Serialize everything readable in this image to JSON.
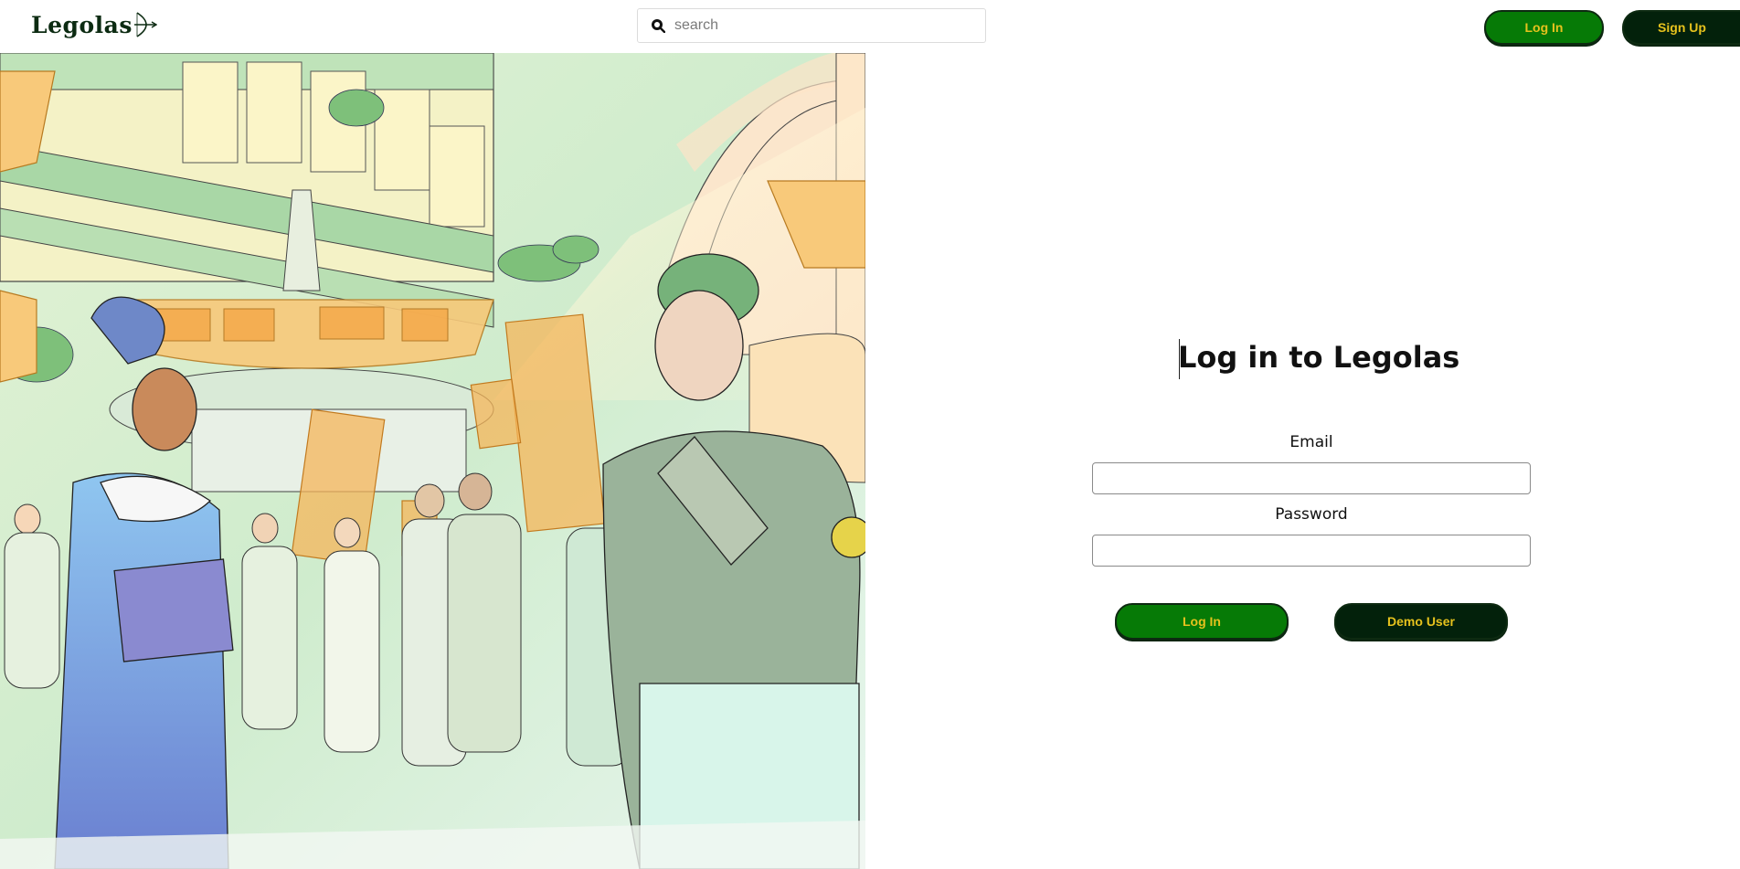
{
  "app": {
    "logo_text": "Legolas"
  },
  "header": {
    "search_placeholder": "search",
    "login_label": "Log In",
    "signup_label": "Sign Up"
  },
  "login_form": {
    "title": "Log in to Legolas",
    "email_label": "Email",
    "email_value": "",
    "password_label": "Password",
    "password_value": "",
    "login_button": "Log In",
    "demo_button": "Demo User"
  },
  "colors": {
    "accent_green": "#067a06",
    "dark_green": "#03210b",
    "button_text_gold": "#e6c21d"
  },
  "icons": {
    "search": "search-icon",
    "logo": "bow-arrow-icon"
  }
}
